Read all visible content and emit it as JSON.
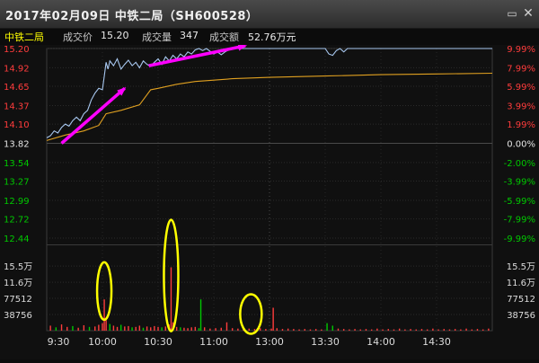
{
  "window": {
    "title": "2017年02月09日  中铁二局（SH600528）",
    "minimize_icon": "minimize-icon",
    "close_icon": "close-icon"
  },
  "info": {
    "name": "中铁二局",
    "price_label": "成交价",
    "price_value": "15.20",
    "volume_label": "成交量",
    "volume_value": "347",
    "amount_label": "成交额",
    "amount_value": "52.76万元"
  },
  "colors": {
    "up": "#ff3c3c",
    "down": "#00c800",
    "neutral": "#e6e6e6",
    "price_line": "#a8c8f0",
    "avg_line": "#e0a020",
    "arrow": "#ff00ff",
    "annotation": "#ffff00",
    "volume_bar_up": "#ff3c3c",
    "volume_bar_down": "#00c800"
  },
  "chart_data": {
    "type": "line",
    "price_ticks": [
      {
        "label": "15.20",
        "value": 15.2,
        "pct": "9.99%",
        "color": "up"
      },
      {
        "label": "14.92",
        "value": 14.92,
        "pct": "7.99%",
        "color": "up"
      },
      {
        "label": "14.65",
        "value": 14.65,
        "pct": "5.99%",
        "color": "up"
      },
      {
        "label": "14.37",
        "value": 14.37,
        "pct": "3.99%",
        "color": "up"
      },
      {
        "label": "14.10",
        "value": 14.1,
        "pct": "1.99%",
        "color": "up"
      },
      {
        "label": "13.82",
        "value": 13.82,
        "pct": "0.00%",
        "color": "neutral"
      },
      {
        "label": "13.54",
        "value": 13.54,
        "pct": "-2.00%",
        "color": "down"
      },
      {
        "label": "13.27",
        "value": 13.27,
        "pct": "-3.99%",
        "color": "down"
      },
      {
        "label": "12.99",
        "value": 12.99,
        "pct": "-5.99%",
        "color": "down"
      },
      {
        "label": "12.72",
        "value": 12.72,
        "pct": "-7.99%",
        "color": "down"
      },
      {
        "label": "12.44",
        "value": 12.44,
        "pct": "-9.99%",
        "color": "down"
      }
    ],
    "volume_ticks": [
      {
        "label": "15.5万",
        "value": 155000
      },
      {
        "label": "11.6万",
        "value": 116000
      },
      {
        "label": "77512",
        "value": 77512
      },
      {
        "label": "38756",
        "value": 38756
      }
    ],
    "time_ticks": [
      "9:30",
      "10:00",
      "10:30",
      "11:00",
      "13:00",
      "13:30",
      "14:00",
      "14:30"
    ],
    "ylim": [
      12.44,
      15.2
    ],
    "volume_ylim": [
      0,
      194000
    ],
    "minutes": 240,
    "price_series": [
      [
        0,
        13.9
      ],
      [
        2,
        13.93
      ],
      [
        4,
        14.0
      ],
      [
        6,
        13.97
      ],
      [
        8,
        14.05
      ],
      [
        10,
        14.1
      ],
      [
        12,
        14.07
      ],
      [
        14,
        14.15
      ],
      [
        16,
        14.2
      ],
      [
        18,
        14.15
      ],
      [
        20,
        14.25
      ],
      [
        22,
        14.3
      ],
      [
        24,
        14.45
      ],
      [
        26,
        14.55
      ],
      [
        28,
        14.62
      ],
      [
        30,
        14.6
      ],
      [
        31,
        14.8
      ],
      [
        32,
        15.0
      ],
      [
        33,
        14.9
      ],
      [
        34,
        15.02
      ],
      [
        36,
        14.95
      ],
      [
        38,
        15.05
      ],
      [
        40,
        14.9
      ],
      [
        42,
        14.97
      ],
      [
        44,
        15.03
      ],
      [
        46,
        14.95
      ],
      [
        48,
        15.0
      ],
      [
        50,
        14.92
      ],
      [
        52,
        15.02
      ],
      [
        54,
        14.97
      ],
      [
        56,
        14.94
      ],
      [
        58,
        15.0
      ],
      [
        60,
        15.05
      ],
      [
        62,
        14.97
      ],
      [
        64,
        15.08
      ],
      [
        66,
        15.02
      ],
      [
        68,
        15.1
      ],
      [
        70,
        15.05
      ],
      [
        72,
        15.12
      ],
      [
        74,
        15.08
      ],
      [
        76,
        15.15
      ],
      [
        78,
        15.12
      ],
      [
        80,
        15.18
      ],
      [
        82,
        15.2
      ],
      [
        84,
        15.17
      ],
      [
        86,
        15.2
      ],
      [
        88,
        15.16
      ],
      [
        90,
        15.12
      ],
      [
        92,
        15.15
      ],
      [
        94,
        15.11
      ],
      [
        96,
        15.15
      ],
      [
        98,
        15.18
      ],
      [
        100,
        15.2
      ],
      [
        120,
        15.2
      ],
      [
        150,
        15.2
      ],
      [
        152,
        15.12
      ],
      [
        154,
        15.1
      ],
      [
        156,
        15.17
      ],
      [
        158,
        15.2
      ],
      [
        160,
        15.15
      ],
      [
        162,
        15.2
      ],
      [
        240,
        15.2
      ]
    ],
    "avg_series": [
      [
        0,
        13.86
      ],
      [
        10,
        13.94
      ],
      [
        20,
        14.0
      ],
      [
        28,
        14.08
      ],
      [
        32,
        14.25
      ],
      [
        40,
        14.3
      ],
      [
        50,
        14.38
      ],
      [
        56,
        14.6
      ],
      [
        60,
        14.62
      ],
      [
        70,
        14.68
      ],
      [
        80,
        14.72
      ],
      [
        90,
        14.74
      ],
      [
        100,
        14.76
      ],
      [
        120,
        14.78
      ],
      [
        150,
        14.8
      ],
      [
        180,
        14.82
      ],
      [
        210,
        14.83
      ],
      [
        240,
        14.84
      ]
    ],
    "volume_series": [
      [
        2,
        12000,
        "up"
      ],
      [
        5,
        8000,
        "down"
      ],
      [
        8,
        15000,
        "up"
      ],
      [
        11,
        9000,
        "up"
      ],
      [
        14,
        11000,
        "down"
      ],
      [
        17,
        7000,
        "up"
      ],
      [
        20,
        13000,
        "up"
      ],
      [
        23,
        9000,
        "down"
      ],
      [
        26,
        10000,
        "up"
      ],
      [
        28,
        14000,
        "up"
      ],
      [
        30,
        18000,
        "up"
      ],
      [
        31,
        75000,
        "up"
      ],
      [
        32,
        25000,
        "up"
      ],
      [
        34,
        16000,
        "down"
      ],
      [
        36,
        12000,
        "up"
      ],
      [
        38,
        9000,
        "up"
      ],
      [
        40,
        14000,
        "down"
      ],
      [
        42,
        10000,
        "up"
      ],
      [
        44,
        11000,
        "up"
      ],
      [
        46,
        8000,
        "down"
      ],
      [
        48,
        9000,
        "up"
      ],
      [
        50,
        12000,
        "up"
      ],
      [
        52,
        7000,
        "down"
      ],
      [
        54,
        10000,
        "up"
      ],
      [
        56,
        8000,
        "up"
      ],
      [
        58,
        11000,
        "up"
      ],
      [
        60,
        9000,
        "up"
      ],
      [
        62,
        8000,
        "down"
      ],
      [
        64,
        10000,
        "up"
      ],
      [
        66,
        15000,
        "up"
      ],
      [
        67,
        152000,
        "up"
      ],
      [
        68,
        20000,
        "up"
      ],
      [
        70,
        9000,
        "up"
      ],
      [
        72,
        8000,
        "down"
      ],
      [
        74,
        7000,
        "up"
      ],
      [
        76,
        6000,
        "up"
      ],
      [
        78,
        8000,
        "up"
      ],
      [
        80,
        9000,
        "up"
      ],
      [
        82,
        6000,
        "down"
      ],
      [
        83,
        75000,
        "down"
      ],
      [
        85,
        8000,
        "up"
      ],
      [
        88,
        5000,
        "up"
      ],
      [
        91,
        6000,
        "up"
      ],
      [
        94,
        7000,
        "up"
      ],
      [
        97,
        20000,
        "up"
      ],
      [
        100,
        6000,
        "up"
      ],
      [
        103,
        5000,
        "up"
      ],
      [
        106,
        4000,
        "up"
      ],
      [
        109,
        5000,
        "up"
      ],
      [
        112,
        4000,
        "up"
      ],
      [
        115,
        6000,
        "up"
      ],
      [
        118,
        4000,
        "up"
      ],
      [
        121,
        5000,
        "up"
      ],
      [
        122,
        55000,
        "up"
      ],
      [
        124,
        6000,
        "up"
      ],
      [
        127,
        4000,
        "up"
      ],
      [
        130,
        5000,
        "up"
      ],
      [
        133,
        4000,
        "up"
      ],
      [
        136,
        3000,
        "up"
      ],
      [
        139,
        4000,
        "up"
      ],
      [
        142,
        3000,
        "up"
      ],
      [
        145,
        4000,
        "up"
      ],
      [
        148,
        3000,
        "up"
      ],
      [
        151,
        18000,
        "down"
      ],
      [
        154,
        12000,
        "down"
      ],
      [
        157,
        5000,
        "up"
      ],
      [
        160,
        4000,
        "up"
      ],
      [
        163,
        3000,
        "up"
      ],
      [
        166,
        4000,
        "up"
      ],
      [
        169,
        3000,
        "up"
      ],
      [
        172,
        4000,
        "up"
      ],
      [
        175,
        3000,
        "up"
      ],
      [
        178,
        5000,
        "up"
      ],
      [
        181,
        3000,
        "up"
      ],
      [
        184,
        4000,
        "up"
      ],
      [
        187,
        3000,
        "up"
      ],
      [
        190,
        5000,
        "up"
      ],
      [
        193,
        3000,
        "up"
      ],
      [
        196,
        4000,
        "up"
      ],
      [
        199,
        3000,
        "up"
      ],
      [
        202,
        4000,
        "up"
      ],
      [
        205,
        3000,
        "up"
      ],
      [
        208,
        5000,
        "up"
      ],
      [
        211,
        3000,
        "up"
      ],
      [
        214,
        4000,
        "up"
      ],
      [
        217,
        3000,
        "up"
      ],
      [
        220,
        4000,
        "up"
      ],
      [
        223,
        3000,
        "up"
      ],
      [
        226,
        5000,
        "up"
      ],
      [
        229,
        3000,
        "up"
      ],
      [
        232,
        4000,
        "up"
      ],
      [
        235,
        3000,
        "up"
      ],
      [
        238,
        5000,
        "up"
      ]
    ],
    "annotations": {
      "circles": [
        {
          "minute": 31,
          "volume": 95000
        },
        {
          "minute": 67,
          "volume": 115000
        },
        {
          "minute": 110,
          "volume": 40000
        }
      ],
      "arrows": [
        {
          "from": [
            8,
            13.82
          ],
          "to": [
            42,
            14.62
          ]
        },
        {
          "from": [
            55,
            14.95
          ],
          "to": [
            107,
            15.24
          ]
        }
      ]
    }
  }
}
